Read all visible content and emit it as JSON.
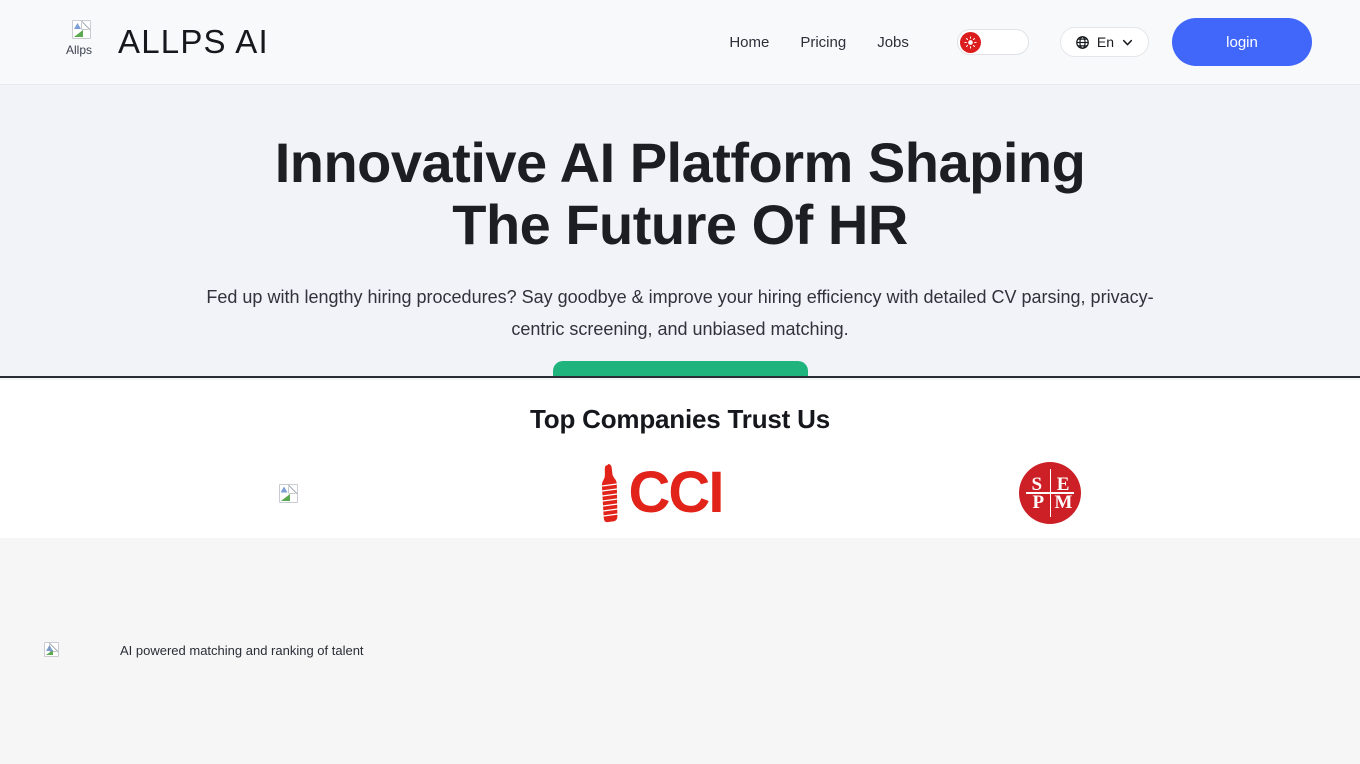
{
  "header": {
    "logo_alt": "Allps",
    "logo_icon": "broken-image-icon",
    "brand_name": "ALLPS AI",
    "nav_links": [
      {
        "label": "Home"
      },
      {
        "label": "Pricing"
      },
      {
        "label": "Jobs"
      }
    ],
    "theme_toggle": {
      "icon": "sun-icon",
      "state": "light",
      "knob_color": "#dc1d1d"
    },
    "language": {
      "icon": "globe-icon",
      "label": "En",
      "chevron": "chevron-down-icon"
    },
    "login_label": "login",
    "login_color": "#4166fa"
  },
  "hero": {
    "title": "Innovative AI Platform Shaping The Future Of HR",
    "subtitle": "Fed up with lengthy hiring procedures? Say goodbye & improve your hiring efficiency with detailed CV parsing, privacy-centric screening, and unbiased matching.",
    "cta_label": "",
    "cta_color": "#1fb37d",
    "background": "#f2f3f9"
  },
  "trust": {
    "title": "Top Companies Trust Us",
    "logos": [
      {
        "name": "broken-image-placeholder",
        "alt": "",
        "type": "broken"
      },
      {
        "name": "cci",
        "text": "CCI",
        "type": "cci",
        "color": "#e2231a"
      },
      {
        "name": "sepm",
        "letters": [
          "S",
          "E",
          "P",
          "M"
        ],
        "type": "sepm",
        "color": "#cc2026"
      }
    ]
  },
  "features": {
    "items": [
      {
        "icon": "broken-image-icon",
        "label": "AI powered matching and ranking of talent"
      }
    ]
  }
}
